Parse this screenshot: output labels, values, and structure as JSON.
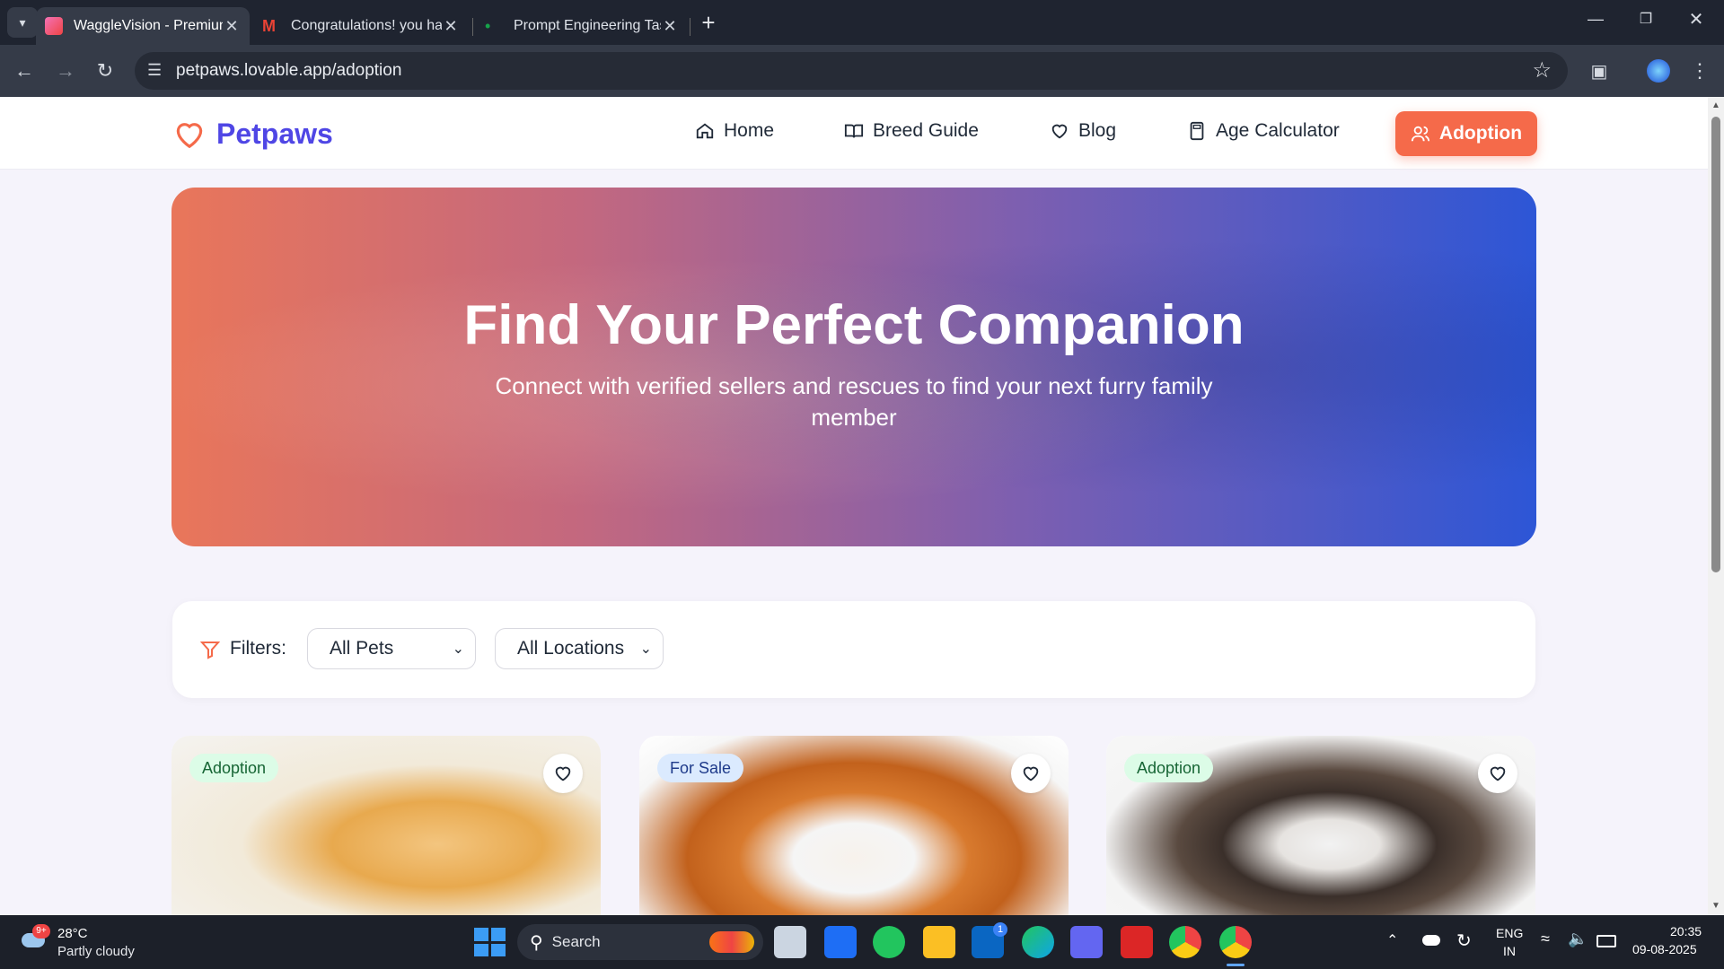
{
  "browser": {
    "tabs": [
      {
        "title": "WaggleVision - Premium Pet Ca",
        "active": true
      },
      {
        "title": "Congratulations! you have been",
        "active": false
      },
      {
        "title": "Prompt Engineering Task 2 – Fu",
        "active": false
      }
    ],
    "url": "petpaws.lovable.app/adoption"
  },
  "nav": {
    "brand": "Petpaws",
    "links": [
      "Home",
      "Breed Guide",
      "Blog",
      "Age Calculator"
    ],
    "cta": "Adoption"
  },
  "hero": {
    "title": "Find Your Perfect Companion",
    "subtitle": "Connect with verified sellers and rescues to find your next furry family member"
  },
  "filters": {
    "label": "Filters:",
    "pets": "All Pets",
    "locations": "All Locations"
  },
  "cards": [
    {
      "badge": "Adoption"
    },
    {
      "badge": "For Sale"
    },
    {
      "badge": "Adoption"
    }
  ],
  "taskbar": {
    "weather_temp": "28°C",
    "weather_desc": "Partly cloudy",
    "weather_badge": "9+",
    "search": "Search",
    "linkedin_badge": "1",
    "lang": "ENG",
    "region": "IN",
    "time": "20:35",
    "date": "09-08-2025"
  },
  "colors": {
    "brand": "#4f46e5",
    "accent": "#f56a4a",
    "adoption_badge_bg": "#dcfce7",
    "adoption_badge_text": "#166534",
    "sale_badge_bg": "#dbeafe",
    "sale_badge_text": "#1e3a8a"
  }
}
